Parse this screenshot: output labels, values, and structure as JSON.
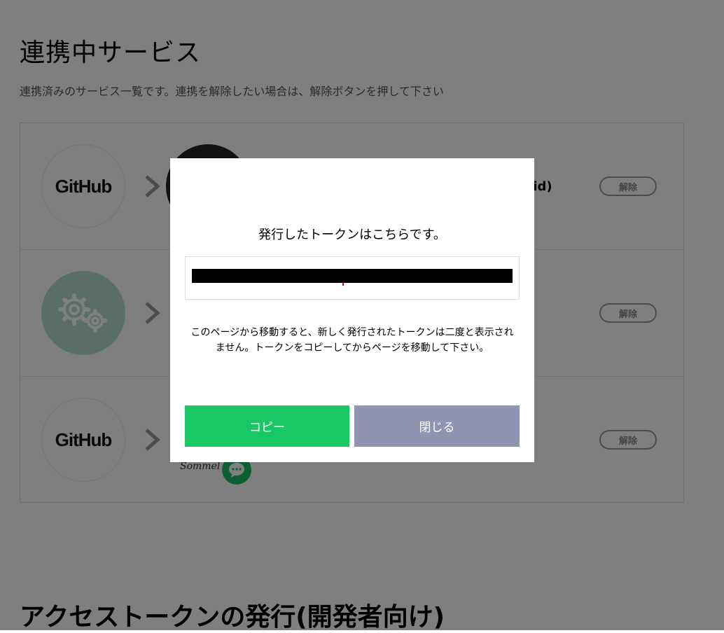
{
  "page": {
    "title": "連携中サービス",
    "subtitle": "連携済みのサービス一覧です。連携を解除したい場合は、解除ボタンを押して下さい",
    "section2_title": "アクセストークンの発行(開発者向け)"
  },
  "services": [
    {
      "logo": "GitHub",
      "logo_icon": "github-wordmark",
      "app_name_fragment": "oid)",
      "release_label": "解除"
    },
    {
      "logo": "",
      "logo_icon": "gears-icon",
      "release_label": "解除"
    },
    {
      "logo": "GitHub",
      "logo_icon": "github-wordmark",
      "app_text": "Sommel",
      "app_icon": "chat-bubble-icon",
      "release_label": "解除"
    }
  ],
  "modal": {
    "title": "発行したトークンはこちらです。",
    "token_value": "",
    "note_line1": "このページから移動すると、新しく発行されたトークンは二度と表示され",
    "note_line2": "ません。トークンをコピーしてからページを移動して下さい。",
    "copy_label": "コピー",
    "close_label": "閉じる"
  },
  "colors": {
    "copy_button": "#19c765",
    "close_button": "#8f94b2",
    "overlay": "rgba(0,0,0,0.5)"
  }
}
